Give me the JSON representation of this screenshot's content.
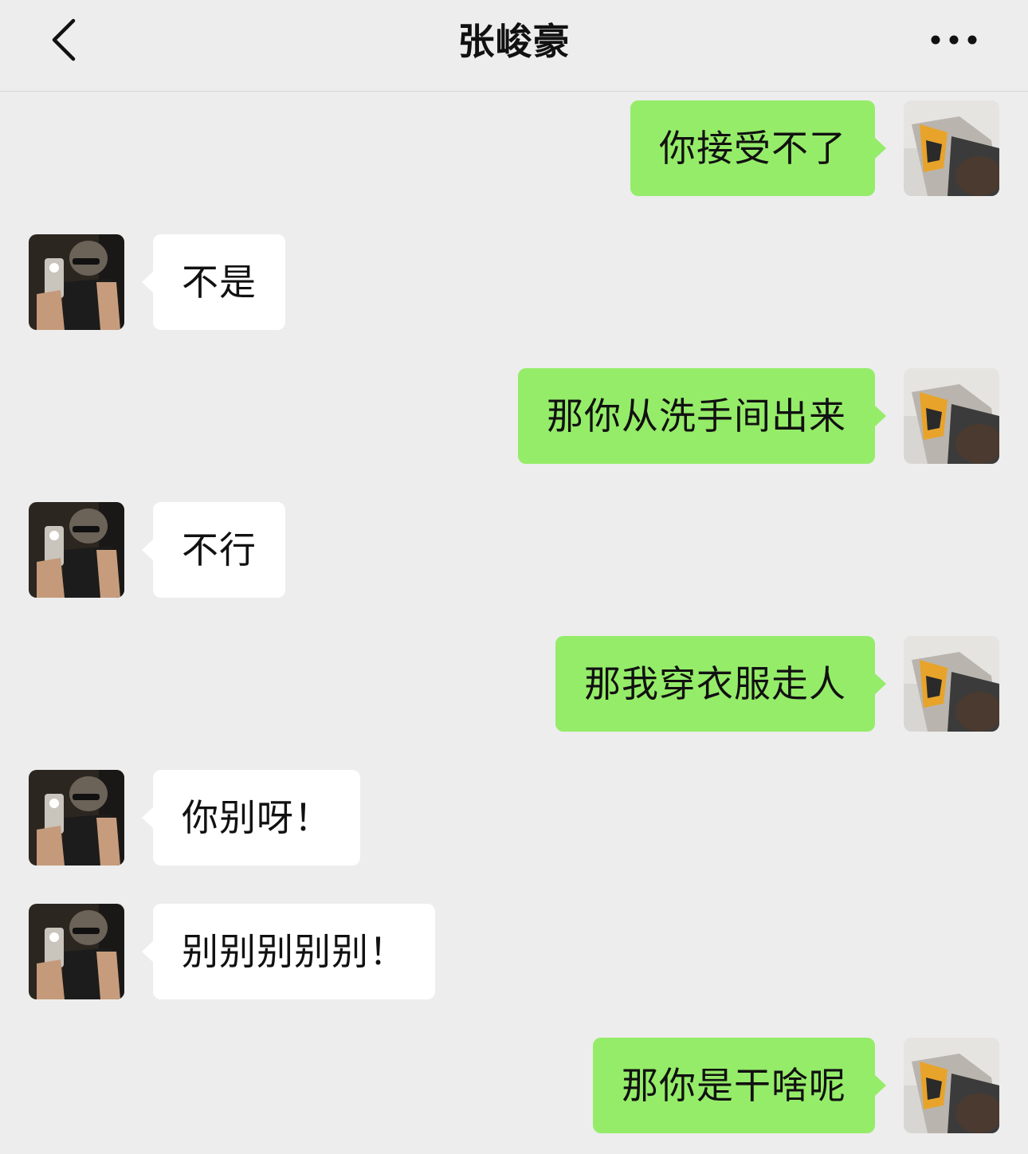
{
  "header": {
    "title": "张峻豪",
    "back_icon": "chevron-left-icon",
    "more_icon": "more-dots-icon"
  },
  "colors": {
    "background": "#ededed",
    "incoming_bubble": "#ffffff",
    "outgoing_bubble": "#95ec69"
  },
  "messages": [
    {
      "direction": "out",
      "text": "你接受不了"
    },
    {
      "direction": "in",
      "text": "不是"
    },
    {
      "direction": "out",
      "text": "那你从洗手间出来"
    },
    {
      "direction": "in",
      "text": "不行"
    },
    {
      "direction": "out",
      "text": "那我穿衣服走人"
    },
    {
      "direction": "in",
      "text": "你别呀！"
    },
    {
      "direction": "in",
      "text": "别别别别别！"
    },
    {
      "direction": "out",
      "text": "那你是干啥呢"
    }
  ]
}
